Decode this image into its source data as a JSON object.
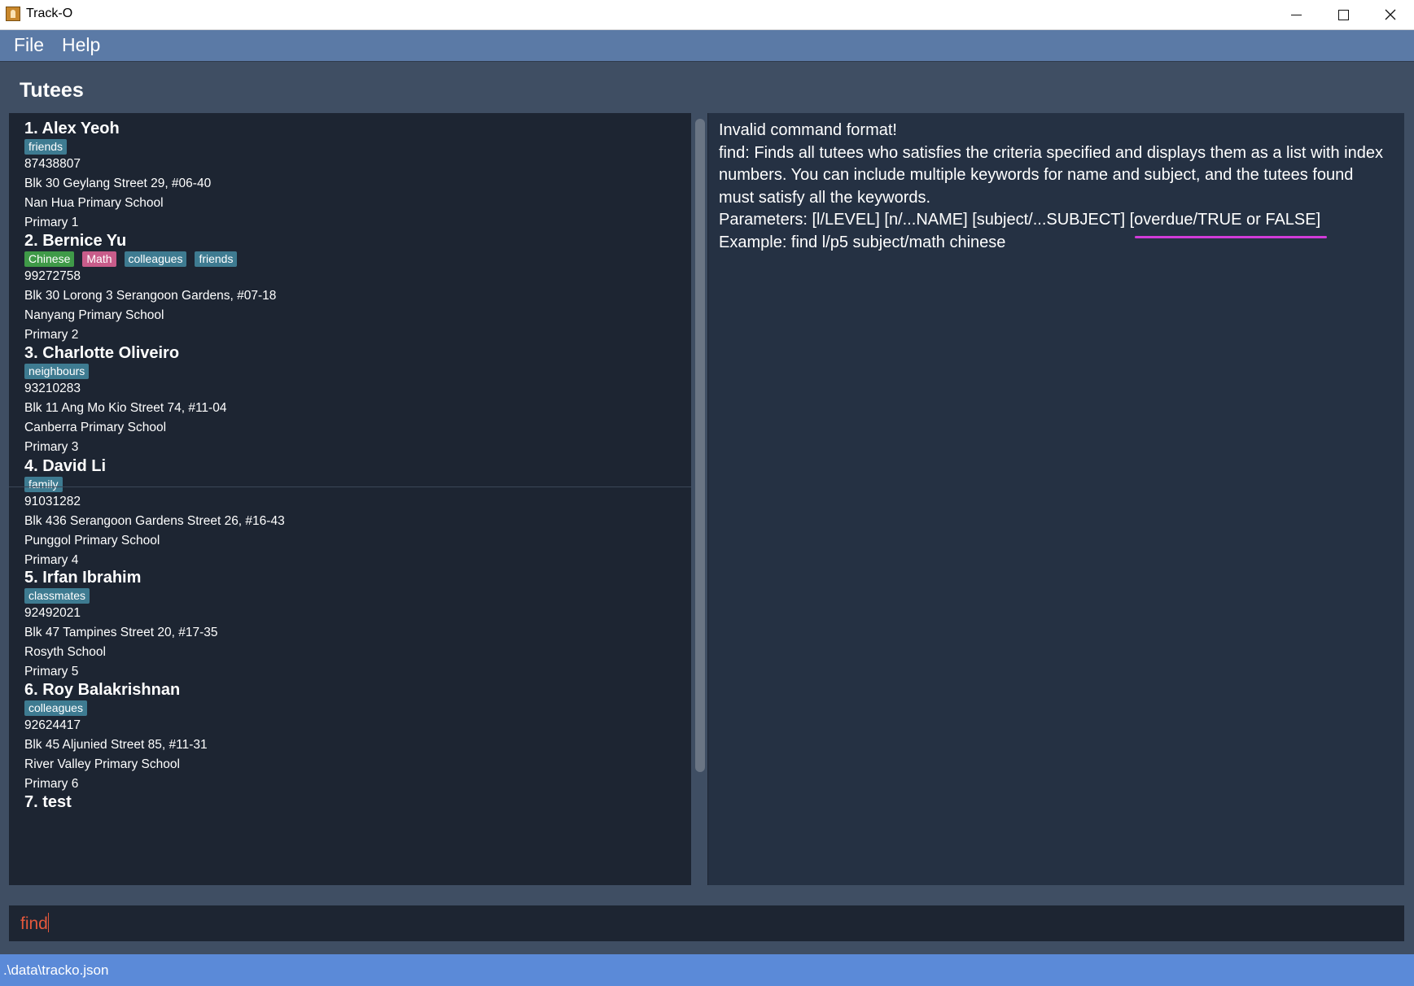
{
  "window": {
    "title": "Track-O",
    "controls": [
      "minimize-icon",
      "maximize-icon",
      "close-icon"
    ]
  },
  "menu": {
    "items": [
      "File",
      "Help"
    ]
  },
  "section_title": "Tutees",
  "tutees": [
    {
      "name": "1.  Alex Yeoh",
      "tags": [
        "friends"
      ],
      "phone": "87438807",
      "address": "Blk 30 Geylang Street 29, #06-40",
      "school": "Nan Hua Primary School",
      "level": "Primary 1"
    },
    {
      "name": "2.  Bernice Yu",
      "tags": [
        "Chinese",
        "Math",
        "colleagues",
        "friends"
      ],
      "phone": "99272758",
      "address": "Blk 30 Lorong 3 Serangoon Gardens, #07-18",
      "school": "Nanyang Primary School",
      "level": "Primary 2"
    },
    {
      "name": "3.  Charlotte Oliveiro",
      "tags": [
        "neighbours"
      ],
      "phone": "93210283",
      "address": "Blk 11 Ang Mo Kio Street 74, #11-04",
      "school": "Canberra Primary School",
      "level": "Primary 3"
    },
    {
      "name": "4.  David Li",
      "tags": [
        "family"
      ],
      "phone": "91031282",
      "address": "Blk 436 Serangoon Gardens Street 26, #16-43",
      "school": "Punggol Primary School",
      "level": "Primary 4"
    },
    {
      "name": "5.  Irfan Ibrahim",
      "tags": [
        "classmates"
      ],
      "phone": "92492021",
      "address": "Blk 47 Tampines Street 20, #17-35",
      "school": "Rosyth School",
      "level": "Primary 5"
    },
    {
      "name": "6.  Roy Balakrishnan",
      "tags": [
        "colleagues"
      ],
      "phone": "92624417",
      "address": "Blk 45 Aljunied Street 85, #11-31",
      "school": "River Valley Primary School",
      "level": "Primary 6"
    },
    {
      "name": "7.  test",
      "tags": [],
      "phone": "",
      "address": "",
      "school": "",
      "level": ""
    }
  ],
  "tag_colors": {
    "Chinese": "#3f9a48",
    "Math": "#c85c8a",
    "default": "#3e7b91"
  },
  "result": {
    "lines": [
      "Invalid command format!",
      "find: Finds all tutees who satisfies the criteria specified and displays them as a list with index numbers. You can include multiple keywords for name and subject, and the tutees found must satisfy all the keywords.",
      "Parameters: [l/LEVEL] [n/...NAME] [subject/...SUBJECT] [overdue/TRUE or FALSE]",
      "Example: find l/p5 subject/math chinese"
    ]
  },
  "command": {
    "value": "find"
  },
  "status": {
    "path": ".\\data\\tracko.json"
  },
  "colors": {
    "background": "#3f4e63",
    "menubar": "#5b7aa6",
    "list_panel": "#1d2532",
    "result_panel": "#253143",
    "statusbar": "#5b8ad8",
    "command_text": "#e4583c"
  }
}
